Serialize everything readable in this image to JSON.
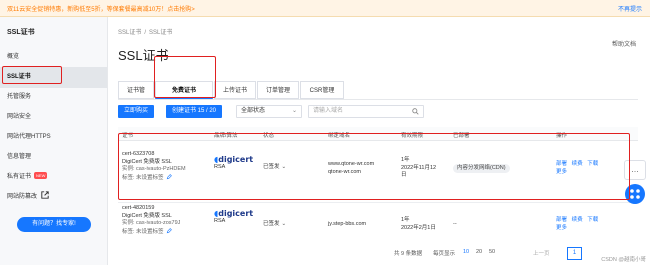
{
  "notice": {
    "text": "双11云安全促销特惠，新购低至5折，等保套餐最高减10万！点击抢购>",
    "close_label": "不再提示"
  },
  "sidebar": {
    "title": "SSL证书",
    "items": [
      {
        "label": "概览"
      },
      {
        "label": "SSL证书"
      },
      {
        "label": "托管服务"
      },
      {
        "label": "网站安全"
      },
      {
        "label": "网站代理HTTPS"
      },
      {
        "label": "信息管理"
      },
      {
        "label": "私有证书",
        "badge": "NEW"
      },
      {
        "label": "网站防篡改"
      }
    ],
    "help_button": "有问题？找专家!"
  },
  "main": {
    "breadcrumb": [
      "SSL证书",
      "SSL证书"
    ],
    "docs_link": "帮助文档",
    "title": "SSL证书",
    "tabs": [
      {
        "label": "证书管理"
      },
      {
        "label": "免费证书"
      },
      {
        "label": "上传证书"
      },
      {
        "label": "订单管理"
      },
      {
        "label": "CSR管理"
      }
    ],
    "toolbar": {
      "buy_label": "立即购买",
      "create_label": "创建证书 15 / 20",
      "status_select": "全部状态",
      "search_placeholder": "请输入域名"
    },
    "table": {
      "columns": [
        "证书",
        "品牌/算法",
        "状态",
        "绑定域名",
        "有效期限",
        "已部署",
        "操作"
      ],
      "rows": [
        {
          "id": "cert-6323708",
          "product": "DigiCert 免费版 SSL",
          "instance": "实例: cas-ivauto-PzHDEM",
          "tag_label": "标签: 未设置标签",
          "brand": "digicert",
          "algorithm": "RSA",
          "status": "已签发",
          "domain1": "www.qtone-wr.com",
          "domain2": "qtone-wr.com",
          "validity": [
            "1年",
            "2022年11月12",
            "日"
          ],
          "deployed": "内容分发网络(CDN)",
          "actions": [
            "部署",
            "续费",
            "下载",
            "更多"
          ]
        },
        {
          "id": "cert-4820159",
          "product": "DigiCert 免费版 SSL",
          "instance": "实例: cas-ivauto-zos79J",
          "tag_label": "标签: 未设置标签",
          "brand": "digicert",
          "algorithm": "RSA",
          "status": "已签发",
          "domain1": "jy.step-bbs.com",
          "domain2": "",
          "validity": [
            "1年",
            "2022年2月1日"
          ],
          "deployed": "--",
          "actions": [
            "部署",
            "续费",
            "下载",
            "更多"
          ]
        }
      ]
    },
    "pagination": {
      "total_label": "共 9 条数据",
      "per_page_label": "每页显示",
      "sizes": [
        "10",
        "20",
        "50"
      ],
      "prev_label": "上一页",
      "current_page": "1"
    }
  },
  "watermark": "CSDN @越南小哥",
  "colors": {
    "primary": "#1677ff",
    "notice_text": "#ff7a00",
    "annotation": "#e02020"
  }
}
